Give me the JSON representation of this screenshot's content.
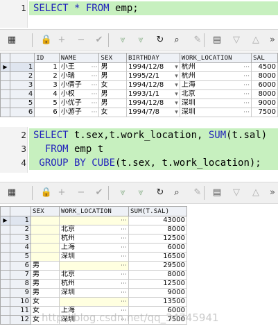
{
  "query1": {
    "line_no": "1",
    "tokens": [
      "SELECT",
      " * ",
      "FROM",
      " emp;"
    ]
  },
  "toolbar_icons": [
    "grid-icon",
    "lock-icon",
    "add-icon",
    "remove-icon",
    "post-icon",
    "filter-down-icon",
    "filter-up-icon",
    "refresh-icon",
    "find-icon",
    "clear-icon",
    "export-icon",
    "sort-desc-icon",
    "sort-asc-icon",
    "more-icon"
  ],
  "grid1": {
    "headers": [
      "ID",
      "NAME",
      "SEX",
      "BIRTHDAY",
      "WORK_LOCATION",
      "SAL"
    ],
    "rows": [
      {
        "rn": "1",
        "id": "1",
        "name": "小王",
        "sex": "男",
        "birthday": "1994/12/8",
        "loc": "杭州",
        "sal": "4500"
      },
      {
        "rn": "2",
        "id": "2",
        "name": "小瑞",
        "sex": "男",
        "birthday": "1995/2/1",
        "loc": "杭州",
        "sal": "8000"
      },
      {
        "rn": "3",
        "id": "3",
        "name": "小倩子",
        "sex": "女",
        "birthday": "1994/12/8",
        "loc": "上海",
        "sal": "6000"
      },
      {
        "rn": "4",
        "id": "4",
        "name": "小权",
        "sex": "男",
        "birthday": "1993/1/1",
        "loc": "北京",
        "sal": "8000"
      },
      {
        "rn": "5",
        "id": "5",
        "name": "小优子",
        "sex": "男",
        "birthday": "1994/12/8",
        "loc": "深圳",
        "sal": "9000"
      },
      {
        "rn": "6",
        "id": "6",
        "name": "小游子",
        "sex": "女",
        "birthday": "1994/7/8",
        "loc": "深圳",
        "sal": "7500"
      }
    ]
  },
  "query2": {
    "lines": [
      {
        "no": "2",
        "parts": [
          [
            "kw",
            "SELECT"
          ],
          [
            "id",
            " t.sex,t.work_location, "
          ],
          [
            "kw",
            "SUM"
          ],
          [
            "id",
            "(t.sal)"
          ]
        ]
      },
      {
        "no": "3",
        "parts": [
          [
            "kw",
            "  FROM"
          ],
          [
            "id",
            " emp t"
          ]
        ]
      },
      {
        "no": "4",
        "parts": [
          [
            "kw",
            " GROUP BY CUBE"
          ],
          [
            "id",
            "(t.sex, t.work_location);"
          ]
        ]
      }
    ]
  },
  "grid2": {
    "headers": [
      "SEX",
      "WORK_LOCATION",
      "SUM(T.SAL)"
    ],
    "rows": [
      {
        "rn": "1",
        "sex": "",
        "loc": "",
        "sum": "43000"
      },
      {
        "rn": "2",
        "sex": "",
        "loc": "北京",
        "sum": "8000"
      },
      {
        "rn": "3",
        "sex": "",
        "loc": "杭州",
        "sum": "12500"
      },
      {
        "rn": "4",
        "sex": "",
        "loc": "上海",
        "sum": "6000"
      },
      {
        "rn": "5",
        "sex": "",
        "loc": "深圳",
        "sum": "16500"
      },
      {
        "rn": "6",
        "sex": "男",
        "loc": "",
        "sum": "29500"
      },
      {
        "rn": "7",
        "sex": "男",
        "loc": "北京",
        "sum": "8000"
      },
      {
        "rn": "8",
        "sex": "男",
        "loc": "杭州",
        "sum": "12500"
      },
      {
        "rn": "9",
        "sex": "男",
        "loc": "深圳",
        "sum": "9000"
      },
      {
        "rn": "10",
        "sex": "女",
        "loc": "",
        "sum": "13500"
      },
      {
        "rn": "11",
        "sex": "女",
        "loc": "上海",
        "sum": "6000"
      },
      {
        "rn": "12",
        "sex": "女",
        "loc": "深圳",
        "sum": "7500"
      }
    ]
  },
  "watermark": "http://blog.csdn.net/qq_34745941",
  "colors": {
    "highlight": "#c7f0bf",
    "keyword": "#2222bb",
    "null_cell": "#ffffe0",
    "header": "#eef1f6"
  }
}
